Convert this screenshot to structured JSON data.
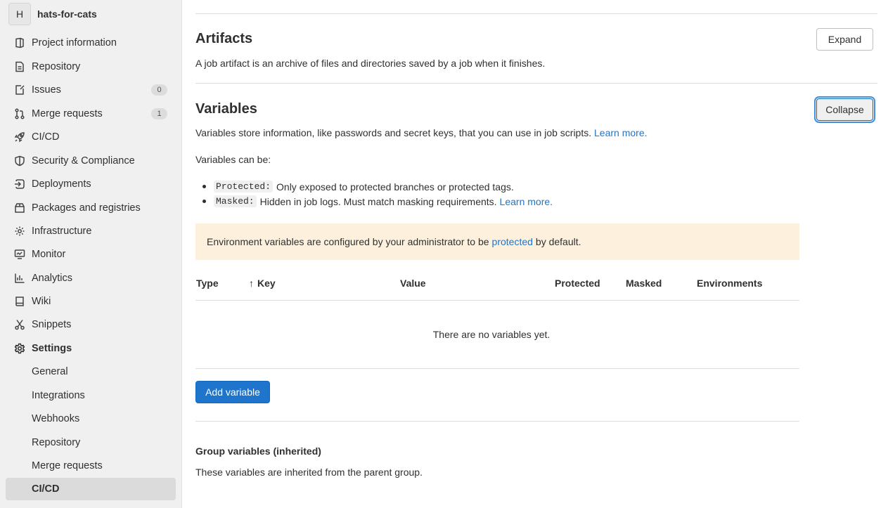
{
  "project": {
    "avatar_letter": "H",
    "name": "hats-for-cats"
  },
  "sidebar": {
    "items": [
      {
        "label": "Project information",
        "icon": "project-icon"
      },
      {
        "label": "Repository",
        "icon": "doc-text-icon"
      },
      {
        "label": "Issues",
        "icon": "issues-icon",
        "badge": "0"
      },
      {
        "label": "Merge requests",
        "icon": "git-merge-icon",
        "badge": "1"
      },
      {
        "label": "CI/CD",
        "icon": "rocket-icon"
      },
      {
        "label": "Security & Compliance",
        "icon": "shield-icon"
      },
      {
        "label": "Deployments",
        "icon": "deployments-icon"
      },
      {
        "label": "Packages and registries",
        "icon": "package-icon"
      },
      {
        "label": "Infrastructure",
        "icon": "cloud-gear-icon"
      },
      {
        "label": "Monitor",
        "icon": "monitor-icon"
      },
      {
        "label": "Analytics",
        "icon": "chart-icon"
      },
      {
        "label": "Wiki",
        "icon": "book-icon"
      },
      {
        "label": "Snippets",
        "icon": "snippet-icon"
      },
      {
        "label": "Settings",
        "icon": "settings-icon"
      }
    ],
    "settings_sub": [
      {
        "label": "General"
      },
      {
        "label": "Integrations"
      },
      {
        "label": "Webhooks"
      },
      {
        "label": "Repository"
      },
      {
        "label": "Merge requests"
      },
      {
        "label": "CI/CD",
        "active": true
      }
    ]
  },
  "artifacts": {
    "title": "Artifacts",
    "description": "A job artifact is an archive of files and directories saved by a job when it finishes.",
    "button": "Expand"
  },
  "variables": {
    "title": "Variables",
    "description": "Variables store information, like passwords and secret keys, that you can use in job scripts.",
    "learn_more": "Learn more.",
    "button": "Collapse",
    "can_be": "Variables can be:",
    "protected_code": "Protected:",
    "protected_text": "Only exposed to protected branches or protected tags.",
    "masked_code": "Masked:",
    "masked_text": "Hidden in job logs. Must match masking requirements.",
    "masked_learn_more": "Learn more.",
    "alert_before": "Environment variables are configured by your administrator to be",
    "alert_link": "protected",
    "alert_after": "by default.",
    "table": {
      "headers": [
        "Type",
        "Key",
        "Value",
        "Protected",
        "Masked",
        "Environments"
      ],
      "empty": "There are no variables yet."
    },
    "add_button": "Add variable",
    "group_title": "Group variables (inherited)",
    "group_desc": "These variables are inherited from the parent group."
  },
  "colors": {
    "sidebar_bg": "#f0f0f0",
    "link": "#1f75cb",
    "primary_button": "#1f75cb",
    "alert_bg": "#fdf1dd"
  }
}
